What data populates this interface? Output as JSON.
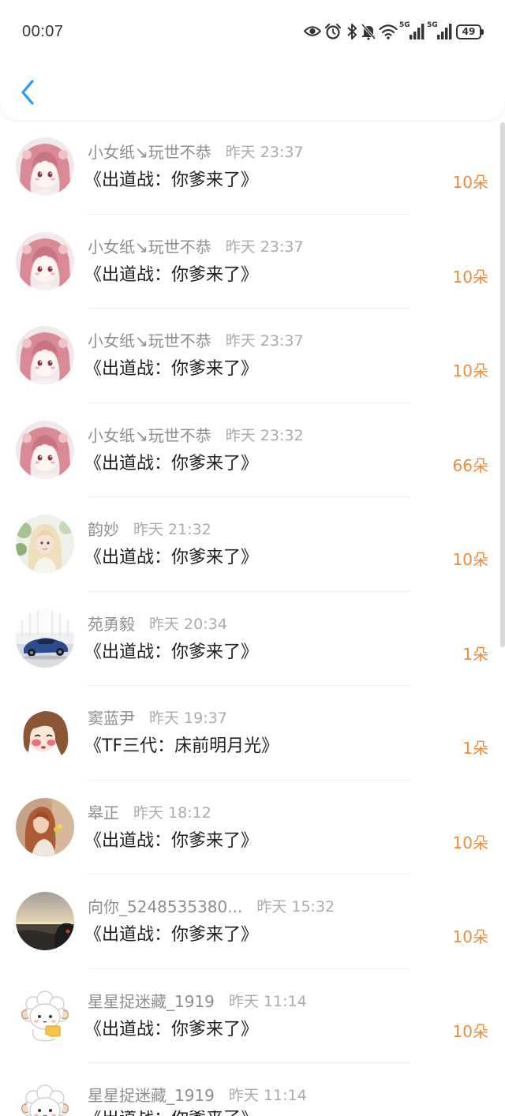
{
  "status_bar": {
    "time": "00:07",
    "icons": [
      "eye-icon",
      "alarm-icon",
      "bluetooth-icon",
      "bell-off-icon",
      "wifi-icon",
      "signal-icon",
      "signal-icon",
      "battery-icon"
    ],
    "signal_1_label": "5G",
    "signal_2_label": "5G",
    "battery_level": "49"
  },
  "header": {
    "back_icon": "chevron-left-icon"
  },
  "colors": {
    "accent": "#2b9af3",
    "amount": "#ef8b3c",
    "title_text": "#1f1f1f",
    "user_text": "#8f8f8f",
    "time_text": "#ababab"
  },
  "gifts": [
    {
      "user": "小女纸↘玩世不恭",
      "time": "昨天 23:37",
      "title": "《出道战：你爹来了》",
      "amount": "10朵"
    },
    {
      "user": "小女纸↘玩世不恭",
      "time": "昨天 23:37",
      "title": "《出道战：你爹来了》",
      "amount": "10朵"
    },
    {
      "user": "小女纸↘玩世不恭",
      "time": "昨天 23:37",
      "title": "《出道战：你爹来了》",
      "amount": "10朵"
    },
    {
      "user": "小女纸↘玩世不恭",
      "time": "昨天 23:32",
      "title": "《出道战：你爹来了》",
      "amount": "66朵"
    },
    {
      "user": "韵妙",
      "time": "昨天 21:32",
      "title": "《出道战：你爹来了》",
      "amount": "10朵"
    },
    {
      "user": "苑勇毅",
      "time": "昨天 20:34",
      "title": "《出道战：你爹来了》",
      "amount": "1朵"
    },
    {
      "user": "窦蓝尹",
      "time": "昨天 19:37",
      "title": "《TF三代：床前明月光》",
      "amount": "1朵"
    },
    {
      "user": "皋正",
      "time": "昨天 18:12",
      "title": "《出道战：你爹来了》",
      "amount": "10朵"
    },
    {
      "user": "向你_5248535380...",
      "time": "昨天 15:32",
      "title": "《出道战：你爹来了》",
      "amount": "10朵"
    },
    {
      "user": "星星捉迷藏_1919",
      "time": "昨天 11:14",
      "title": "《出道战：你爹来了》",
      "amount": "10朵"
    },
    {
      "user": "星星捉迷藏_1919",
      "time": "昨天 11:14",
      "title": "《出道战：你爹来了》"
    }
  ]
}
